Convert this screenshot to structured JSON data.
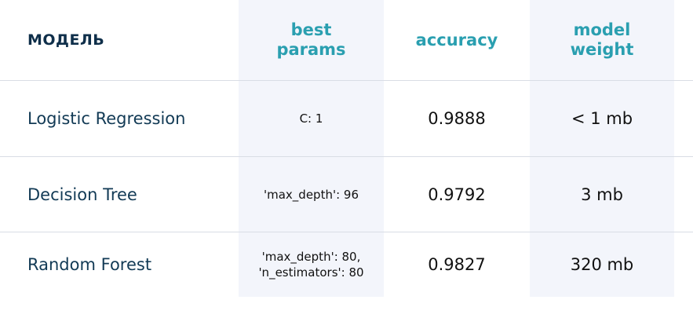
{
  "header": {
    "model": "МОДЕЛЬ",
    "best_params": "best\nparams",
    "accuracy": "accuracy",
    "model_weight": "model\nweight"
  },
  "rows": [
    {
      "model": "Logistic Regression",
      "params": "C: 1",
      "accuracy": "0.9888",
      "weight": "< 1 mb"
    },
    {
      "model": "Decision Tree",
      "params": "'max_depth': 96",
      "accuracy": "0.9792",
      "weight": "3 mb"
    },
    {
      "model": "Random Forest",
      "params": "'max_depth': 80,\n'n_estimators': 80",
      "accuracy": "0.9827",
      "weight": "320 mb"
    }
  ],
  "colors": {
    "header_accent": "#2a9fb0",
    "header_dark": "#0f2f4a",
    "shaded_column": "#f3f5fb"
  }
}
